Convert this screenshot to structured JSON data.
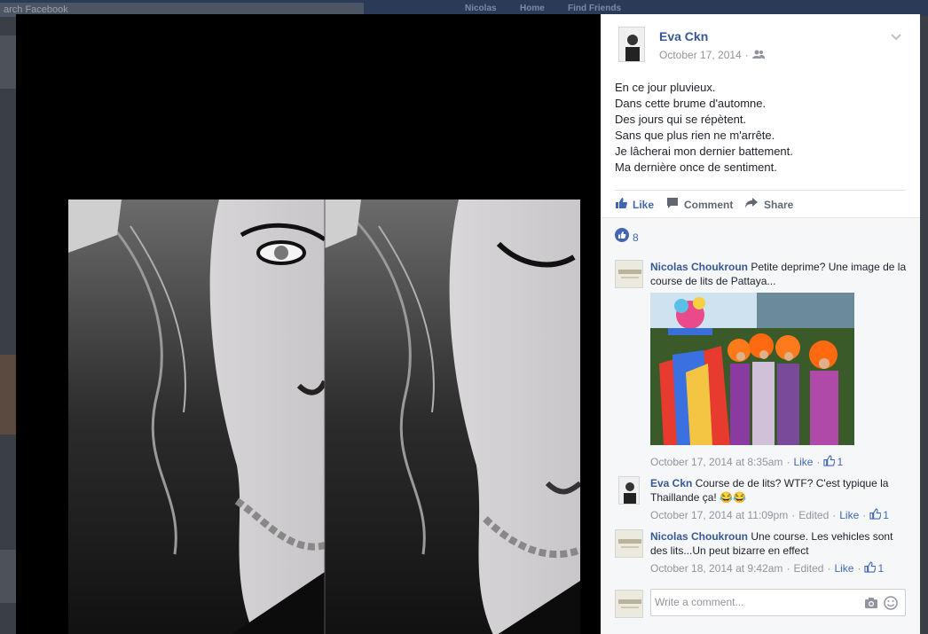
{
  "background_page": {
    "search_placeholder": "arch Facebook",
    "nav": [
      "Nicolas",
      "Home",
      "Find Friends"
    ]
  },
  "post": {
    "author": "Eva Ckn",
    "date": "October 17, 2014",
    "audience_icon": "friends-icon",
    "menu_icon": "chevron-down-icon",
    "lines": [
      "En ce jour pluvieux.",
      "Dans cette brume d'automne.",
      "Des jours qui se répètent.",
      "Sans que plus rien ne m'arrête.",
      "Je lâcherai mon dernier battement.",
      "Ma dernière once de sentiment."
    ],
    "actions": {
      "like": "Like",
      "comment": "Comment",
      "share": "Share"
    },
    "like_count": "8"
  },
  "comments": [
    {
      "author": "Nicolas Choukroun",
      "text": "Petite deprime? Une image de la course de lits de Pattaya...",
      "has_image": true,
      "date": "October 17, 2014 at 8:35am",
      "edited": "",
      "like_label": "Like",
      "likes": "1"
    },
    {
      "author": "Eva Ckn",
      "text": "Course de de lits? WTF? C'est typique la Thaillande ça! 😂😂",
      "has_image": false,
      "date": "October 17, 2014 at 11:09pm",
      "edited": "Edited",
      "like_label": "Like",
      "likes": "1"
    },
    {
      "author": "Nicolas Choukroun",
      "text": "Une course. Les vehicles sont des lits...Un peut bizarre en effect",
      "has_image": false,
      "date": "October 18, 2014 at 9:42am",
      "edited": "Edited",
      "like_label": "Like",
      "likes": "1"
    }
  ],
  "comment_box": {
    "placeholder": "Write a comment..."
  },
  "colors": {
    "link": "#365899",
    "like_blue": "#4267b2",
    "panel_bg": "#f6f7f9"
  }
}
